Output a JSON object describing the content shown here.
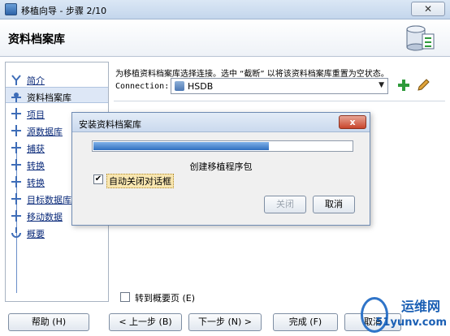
{
  "window": {
    "title": "移植向导 - 步骤 2/10",
    "close": "✕"
  },
  "header": {
    "title": "资料档案库"
  },
  "nav": {
    "items": [
      {
        "label": "简介",
        "state": "done"
      },
      {
        "label": "资料档案库",
        "state": "active"
      },
      {
        "label": "项目",
        "state": "pending"
      },
      {
        "label": "源数据库",
        "state": "pending"
      },
      {
        "label": "捕获",
        "state": "pending"
      },
      {
        "label": "转换",
        "state": "pending"
      },
      {
        "label": "转换",
        "state": "pending"
      },
      {
        "label": "目标数据库",
        "state": "pending"
      },
      {
        "label": "移动数据",
        "state": "pending"
      },
      {
        "label": "概要",
        "state": "pending"
      }
    ]
  },
  "main": {
    "instruction": "为移植资料档案库选择连接。选中 “截断” 以将该资料档案库重置为空状态。",
    "connection_label": "Connection:",
    "connection_value": "HSDB",
    "summary_checkbox": "转到概要页 (E)"
  },
  "buttons": {
    "help": "帮助 (H)",
    "back": "< 上一步 (B)",
    "next": "下一步 (N) >",
    "finish": "完成 (F)",
    "cancel": "取消"
  },
  "dialog": {
    "title": "安装资料档案库",
    "close": "x",
    "progress": 0.68,
    "status": "创建移植程序包",
    "auto_close_label": "自动关闭对话框",
    "auto_close_checked": true,
    "close_button": "关闭",
    "cancel_button": "取消"
  },
  "watermark": {
    "line1": "运维网",
    "line2": "51yunv.com"
  },
  "colors": {
    "accent": "#2f6fc0",
    "nav_link": "#0a2a7a",
    "active_bg": "#dde7f6"
  }
}
